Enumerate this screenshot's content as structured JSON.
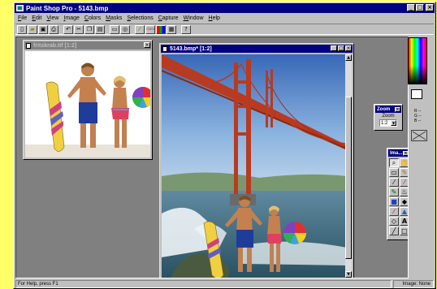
{
  "window": {
    "title": "Paint Shop Pro - 5143.bmp"
  },
  "menu": [
    "File",
    "Edit",
    "View",
    "Image",
    "Colors",
    "Masks",
    "Selections",
    "Capture",
    "Window",
    "Help"
  ],
  "toolbar": {
    "buttons": [
      "new-icon",
      "open-icon",
      "save-icon",
      "print-icon",
      "undo-icon",
      "cut-icon",
      "copy-icon",
      "paste-icon",
      "screen-icon",
      "color-icon",
      "brush-icon",
      "text-icon",
      "color-bars-icon",
      "image-icon",
      "help-icon"
    ]
  },
  "documents": [
    {
      "title": "fritskrab.tif [1:2]",
      "state": "inactive"
    },
    {
      "title": "5143.bmp* [1:2]",
      "state": "active"
    }
  ],
  "zoom_palette": {
    "title": "Zoom",
    "label": "Zoom",
    "value": "1:2"
  },
  "tools_palette": {
    "title": "Ima..."
  },
  "color_panel": {
    "r": "R --",
    "g": "G --",
    "b": "B --"
  },
  "status": {
    "left": "For Help, press F1",
    "right": "Image: None"
  },
  "colors": {
    "title_active": "#000080",
    "face": "#c0c0c0",
    "desktop": "#ffff66"
  }
}
